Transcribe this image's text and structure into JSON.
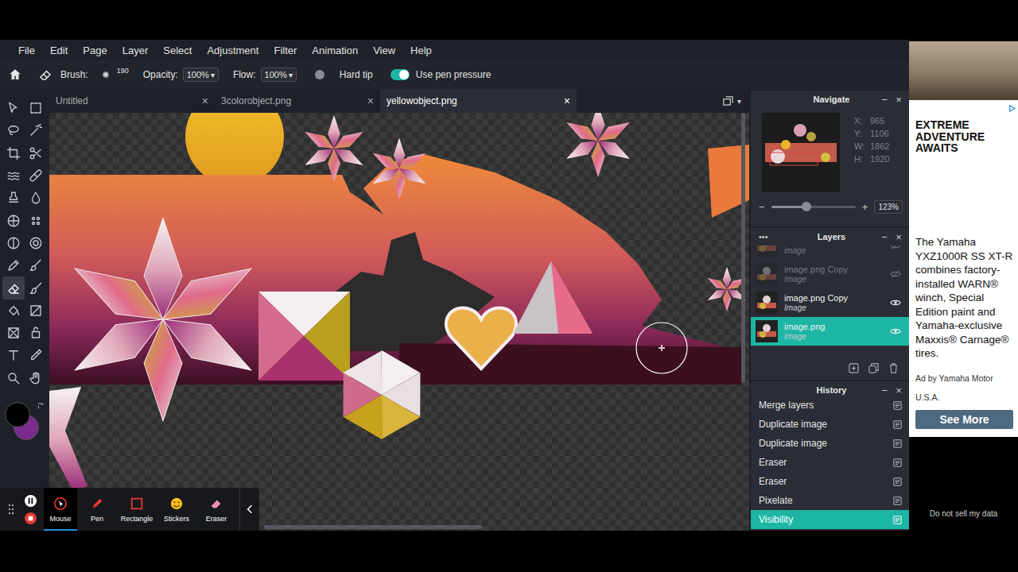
{
  "menu": [
    "File",
    "Edit",
    "Page",
    "Layer",
    "Select",
    "Adjustment",
    "Filter",
    "Animation",
    "View",
    "Help"
  ],
  "options": {
    "brush_label": "Brush:",
    "brush_size": "190",
    "opacity_label": "Opacity:",
    "opacity": "100%",
    "flow_label": "Flow:",
    "flow": "100%",
    "caret": "▾",
    "toggles": [
      {
        "label": "Hard tip",
        "on": false
      },
      {
        "label": "Use pen pressure",
        "on": true
      }
    ]
  },
  "tools": [
    {
      "selected": false
    },
    {
      "selected": false
    },
    {
      "selected": false
    },
    {
      "selected": false
    },
    {
      "selected": false
    },
    {
      "selected": false
    },
    {
      "selected": false
    },
    {
      "selected": false
    },
    {
      "selected": false
    },
    {
      "selected": false
    },
    {
      "selected": false
    },
    {
      "selected": false
    },
    {
      "selected": false
    },
    {
      "selected": false
    },
    {
      "selected": false
    },
    {
      "selected": false
    },
    {
      "selected": true
    },
    {
      "selected": false
    },
    {
      "selected": false
    },
    {
      "selected": false
    },
    {
      "selected": false
    },
    {
      "selected": false
    },
    {
      "selected": false
    },
    {
      "selected": false
    },
    {
      "selected": false
    },
    {
      "selected": false
    }
  ],
  "colors": {
    "foreground": "#000000",
    "background": "#7b2a8e"
  },
  "tabs": [
    {
      "label": "Untitled",
      "close": "×",
      "selected": false
    },
    {
      "label": "3colorobject.png",
      "close": "×",
      "selected": false
    },
    {
      "label": "yellowobject.png",
      "close": "×",
      "selected": true
    }
  ],
  "tab_menu_caret": "▾",
  "navigate": {
    "title": "Navigate",
    "minimize": "−",
    "close": "×",
    "stats": [
      {
        "label": "X:",
        "value": "965"
      },
      {
        "label": "Y:",
        "value": "1106"
      },
      {
        "label": "W:",
        "value": "1862"
      },
      {
        "label": "H:",
        "value": "1920"
      }
    ],
    "zoom_out": "−",
    "zoom_in": "+",
    "zoom": "123%",
    "zoom_level": 0.42
  },
  "layers": {
    "menu": "•••",
    "title": "Layers",
    "minimize": "−",
    "close": "×",
    "items": [
      {
        "name": "",
        "type": "image",
        "visible": false,
        "selected": false
      },
      {
        "name": "image.png Copy",
        "type": "Image",
        "visible": false,
        "selected": false
      },
      {
        "name": "image.png Copy",
        "type": "Image",
        "visible": true,
        "selected": false
      },
      {
        "name": "image.png",
        "type": "Image",
        "visible": true,
        "selected": true
      }
    ]
  },
  "history": {
    "title": "History",
    "minimize": "−",
    "close": "×",
    "items": [
      {
        "label": "Merge layers",
        "selected": false
      },
      {
        "label": "Duplicate image",
        "selected": false
      },
      {
        "label": "Duplicate image",
        "selected": false
      },
      {
        "label": "Eraser",
        "selected": false
      },
      {
        "label": "Eraser",
        "selected": false
      },
      {
        "label": "Pixelate",
        "selected": false
      },
      {
        "label": "Visibility",
        "selected": true
      }
    ]
  },
  "recorder": {
    "tools": [
      {
        "label": "Mouse",
        "selected": true
      },
      {
        "label": "Pen",
        "selected": false
      },
      {
        "label": "Rectangle",
        "selected": false
      },
      {
        "label": "Stickers",
        "selected": false
      },
      {
        "label": "Eraser",
        "selected": false
      }
    ]
  },
  "ad": {
    "headline": "EXTREME ADVENTURE AWAITS",
    "body": "The Yamaha YXZ1000R SS XT-R combines factory-installed WARN® winch, Special Edition paint and Yamaha-exclusive Maxxis® Carnage® tires.",
    "sponsor": "Ad by Yamaha Motor",
    "region": "U.S.A.",
    "button": "See More"
  },
  "privacy": "Do not sell my data"
}
